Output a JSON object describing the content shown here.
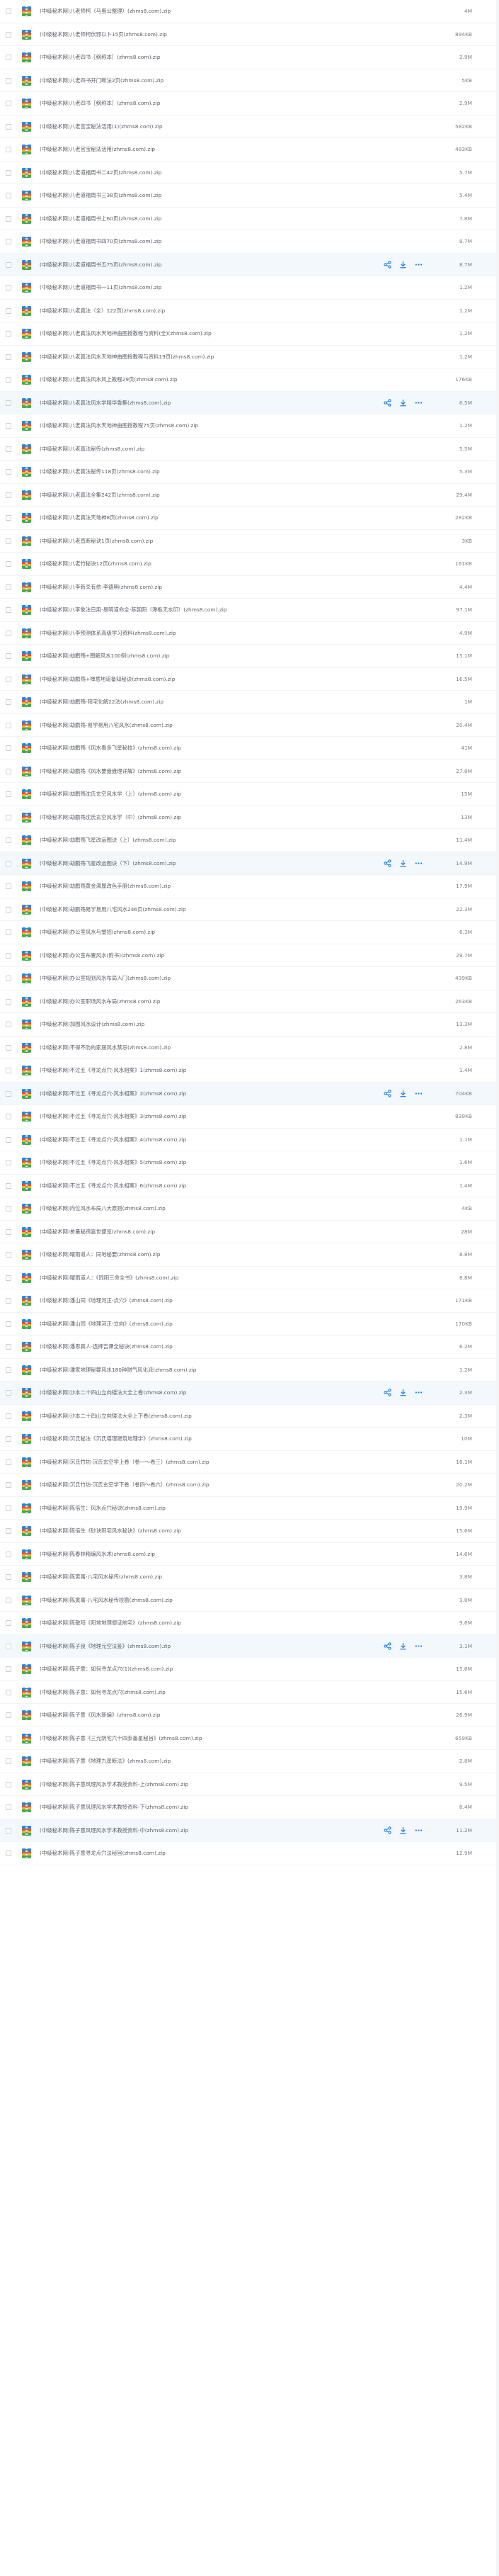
{
  "colors": {
    "accent": "#1f7fe6",
    "row_highlight": "#f3f8fd",
    "text": "#5a5e66",
    "size_text": "#7b8089"
  },
  "icons": {
    "file": "zip-file-icon",
    "checkbox": "checkbox-icon",
    "share": "share-icon",
    "download": "download-icon",
    "more": "more-icon"
  },
  "files": [
    {
      "name": "(中级秘术网)八老师柯（马蛋公整理）(zhms8.com).zip",
      "size": "4M"
    },
    {
      "name": "(中级秘术网)八老师柯伏邪以卜15页(zhms8.com).zip",
      "size": "894KB"
    },
    {
      "name": "(中级秘术网)八老四书［纲称本］(zhms8.com).zip",
      "size": "2.9M"
    },
    {
      "name": "(中级秘术网)八老四书开门断法2页(zhms8.com).zip",
      "size": "5KB"
    },
    {
      "name": "(中级秘术网)八老四书［纲称本］(zhms8.com).zip",
      "size": "2.9M"
    },
    {
      "name": "(中级秘术网)八老宫宝秘法活用(1)(zhms8.com).zip",
      "size": "582KB"
    },
    {
      "name": "(中级秘术网)八老宫宝秘法活用(zhms8.com).zip",
      "size": "483KB"
    },
    {
      "name": "(中级秘术网)八老道福周书二42页(zhms8.com).zip",
      "size": "5.7M"
    },
    {
      "name": "(中级秘术网)八老道福周书三38页(zhms8.com).zip",
      "size": "5.4M"
    },
    {
      "name": "(中级秘术网)八老道福周书上60页(zhms8.com).zip",
      "size": "7.8M"
    },
    {
      "name": "(中级秘术网)八老道福周书四70页(zhms8.com).zip",
      "size": "8.7M"
    },
    {
      "name": "(中级秘术网)八老道福周书五75页(zhms8.com).zip",
      "size": "8.7M",
      "hl": true
    },
    {
      "name": "(中级秘术网)八老道福周书一11页(zhms8.com).zip",
      "size": "1.2M"
    },
    {
      "name": "(中级秘术网)八老真法（全）122页(zhms8.com).zip",
      "size": "1.2M"
    },
    {
      "name": "(中级秘术网)八老真法风水天地神曲图授教程与资料(全)(zhms8.com).zip",
      "size": "1.2M"
    },
    {
      "name": "(中级秘术网)八老真法风水天地神曲图授教程与资料19页(zhms8.com).zip",
      "size": "1.2M"
    },
    {
      "name": "(中级秘术网)八老真法风水风上教程29页(zhms8.com).zip",
      "size": "176KB"
    },
    {
      "name": "(中级秘术网)八老真法风水学精华香集(zhms8.com).zip",
      "size": "6.5M",
      "hl": true
    },
    {
      "name": "(中级秘术网)八老真法风水天地神曲图授教程75页(zhms8.com).zip",
      "size": "1.2M"
    },
    {
      "name": "(中级秘术网)八老真法秘传(zhms8.com).zip",
      "size": "5.5M"
    },
    {
      "name": "(中级秘术网)八老真法秘传118页(zhms8.com).zip",
      "size": "5.3M"
    },
    {
      "name": "(中级秘术网)八老真法全集242页(zhms8.com).zip",
      "size": "29.4M"
    },
    {
      "name": "(中级秘术网)八老真法天地神8页(zhms8.com).zip",
      "size": "282KB"
    },
    {
      "name": "(中级秘术网)八老直断秘诀1页(zhms8.com).zip",
      "size": "3KB"
    },
    {
      "name": "(中级秘术网)八老竹秘诀12页(zhms8.com).zip",
      "size": "161KB"
    },
    {
      "name": "(中级秘术网)八李新爻有依-李德明(zhms8.com).zip",
      "size": "4.4M"
    },
    {
      "name": "(中级秘术网)八李象法日用-易明道命全-陈朝阳（潭板无水印）(zhms8.com).zip",
      "size": "97.1M"
    },
    {
      "name": "(中级秘术网)八李预测体系高级学习资料(zhms8.com).zip",
      "size": "4.9M"
    },
    {
      "name": "(中级秘术网)劫鹏殇+图解风水100例(zhms8.com).zip",
      "size": "15.1M"
    },
    {
      "name": "(中级秘术网)劫鹏殇+禅意地道备知秘诀(zhms8.com).zip",
      "size": "16.5M"
    },
    {
      "name": "(中级秘术网)劫鹏殇-阳宅化解22法(zhms8.com).zip",
      "size": "1M"
    },
    {
      "name": "(中级秘术网)劫鹏殇-易学易用八宅风水(zhms8.com).zip",
      "size": "20.4M"
    },
    {
      "name": "(中级秘术网)劫鹏殇《风水看多飞星秘技》(zhms8.com).zip",
      "size": "41M"
    },
    {
      "name": "(中级秘术网)劫鹏殇《风水要盘盘理详解》(zhms8.com).zip",
      "size": "27.8M"
    },
    {
      "name": "(中级秘术网)劫鹏殇沈氏玄空风水学（上）(zhms8.com).zip",
      "size": "15M"
    },
    {
      "name": "(中级秘术网)劫鹏殇沈氏玄空风水学（中）(zhms8.com).zip",
      "size": "13M"
    },
    {
      "name": "(中级秘术网)劫鹏殇飞星改运图诀（上）(zhms8.com).zip",
      "size": "11.4M"
    },
    {
      "name": "(中级秘术网)劫鹏殇飞星改运图诀（下）(zhms8.com).zip",
      "size": "14.9M",
      "hl": true
    },
    {
      "name": "(中级秘术网)劫鹏殇黄金满屋改色手册(zhms8.com).zip",
      "size": "17.9M"
    },
    {
      "name": "(中级秘术网)劫鹏殇易学易用八宅风水246页(zhms8.com).zip",
      "size": "22.3M"
    },
    {
      "name": "(中级秘术网)办公室风水与塑招(zhms8.com).zip",
      "size": "6.3M"
    },
    {
      "name": "(中级秘术网)办公室布置风水(附书)(zhms8.com).zip",
      "size": "29.7M"
    },
    {
      "name": "(中级秘术网)办公室规划风水布局入门(zhms8.com).zip",
      "size": "439KB"
    },
    {
      "name": "(中级秘术网)办公室职场风水布局(zhms8.com).zip",
      "size": "263KB"
    },
    {
      "name": "(中级秘术网)加图风水设计(zhms8.com).zip",
      "size": "13.3M"
    },
    {
      "name": "(中级秘术网)不得不防的家居风水禁忌(zhms8.com).zip",
      "size": "2.8M"
    },
    {
      "name": "(中级秘术网)不过五《寻龙点穴-风水相案》1(zhms8.com).zip",
      "size": "1.4M"
    },
    {
      "name": "(中级秘术网)不过五《寻龙点穴-风水相案》2(zhms8.com).zip",
      "size": "704KB",
      "hl": true
    },
    {
      "name": "(中级秘术网)不过五《寻龙点穴-风水相案》3(zhms8.com).zip",
      "size": "839KB"
    },
    {
      "name": "(中级秘术网)不过五《寻龙点穴-风水相案》4(zhms8.com).zip",
      "size": "1.1M"
    },
    {
      "name": "(中级秘术网)不过五《寻龙点穴-风水相案》5(zhms8.com).zip",
      "size": "1.6M"
    },
    {
      "name": "(中级秘术网)不过五《寻龙点穴-风水相案》6(zhms8.com).zip",
      "size": "1.4M"
    },
    {
      "name": "(中级秘术网)向位风水布局八大原则(zhms8.com).zip",
      "size": "4KB"
    },
    {
      "name": "(中级秘术网)参量秘窍嘉世便览(zhms8.com).zip",
      "size": "28M"
    },
    {
      "name": "(中级秘术网)曜雨道人：同地秘要(zhms8.com).zip",
      "size": "8.8M"
    },
    {
      "name": "(中级秘术网)曜雨道人：《同阳三命全书》(zhms8.com).zip",
      "size": "8.8M"
    },
    {
      "name": "(中级秘术网)潘山同《地理河正-点穴》(zhms8.com).zip",
      "size": "171KB"
    },
    {
      "name": "(中级秘术网)潘山同《地理河正-立向》(zhms8.com).zip",
      "size": "170KB"
    },
    {
      "name": "(中级秘术网)潘思真人-选择吉课全秘诀(zhms8.com).zip",
      "size": "6.2M"
    },
    {
      "name": "(中级秘术网)潘家地理秘要风水180种财气风化派(zhms8.com).zip",
      "size": "1.2M"
    },
    {
      "name": "(中级秘术网)沙本二十四山立向矮法大全上卷(zhms8.com).zip",
      "size": "2.3M",
      "hl": true
    },
    {
      "name": "(中级秘术网)沙本二十四山立向矮法大全上下卷(zhms8.com).zip",
      "size": "2.3M"
    },
    {
      "name": "(中级秘术网)沉氏秘法《沉氏堪理建筑地理学》(zhms8.com).zip",
      "size": "10M"
    },
    {
      "name": "(中级秘术网)沉氏竹坊-沉氏玄空学上卷（卷一～卷三）(zhms8.com).zip",
      "size": "16.1M"
    },
    {
      "name": "(中级秘术网)沉氏竹坊-沉氏玄空学下卷（卷四～卷六）(zhms8.com).zip",
      "size": "20.2M"
    },
    {
      "name": "(中级秘术网)陈倍生：风水点穴秘诀(zhms8.com).zip",
      "size": "19.9M"
    },
    {
      "name": "(中级秘术网)陈倍生《砂诀阳宅风水秘诀》(zhms8.com).zip",
      "size": "15.6M"
    },
    {
      "name": "(中级秘术网)陈春林精编风水术(zhms8.com).zip",
      "size": "14.6M"
    },
    {
      "name": "(中级秘术网)陈寅寓-八宅风水秘传(zhms8.com).zip",
      "size": "3.8M"
    },
    {
      "name": "(中级秘术网)陈寅寓-八宅风水秘传校勘(zhms8.com).zip",
      "size": "3.8M"
    },
    {
      "name": "(中级秘术网)陈敬阳《阳地地理便证前宅》(zhms8.com).zip",
      "size": "9.6M"
    },
    {
      "name": "(中级秘术网)陈子良《地理元空法鉴》(zhms8.com).zip",
      "size": "3.1M",
      "hl": true
    },
    {
      "name": "(中级秘术网)陈子意：如何寻龙点穴(1)(zhms8.com).zip",
      "size": "15.6M"
    },
    {
      "name": "(中级秘术网)陈子意：如何寻龙点穴(zhms8.com).zip",
      "size": "15.6M"
    },
    {
      "name": "(中级秘术网)陈子意《风水新编》(zhms8.com).zip",
      "size": "26.9M"
    },
    {
      "name": "(中级秘术网)陈子意《三元阴宅六十四卦备星秘旨》(zhms8.com).zip",
      "size": "659KB"
    },
    {
      "name": "(中级秘术网)陈子意《地理九星断法》(zhms8.com).zip",
      "size": "2.8M"
    },
    {
      "name": "(中级秘术网)陈子意风理风水学术教授资料-上(zhms8.com).zip",
      "size": "9.5M"
    },
    {
      "name": "(中级秘术网)陈子意风理风水学术教授资料-下(zhms8.com).zip",
      "size": "8.4M"
    },
    {
      "name": "(中级秘术网)陈子意风理风水学术教授资料-中(zhms8.com).zip",
      "size": "11.2M",
      "hl": true
    },
    {
      "name": "(中级秘术网)陈子意寻龙点穴法秘旨(zhms8.com).zip",
      "size": "12.9M"
    }
  ]
}
